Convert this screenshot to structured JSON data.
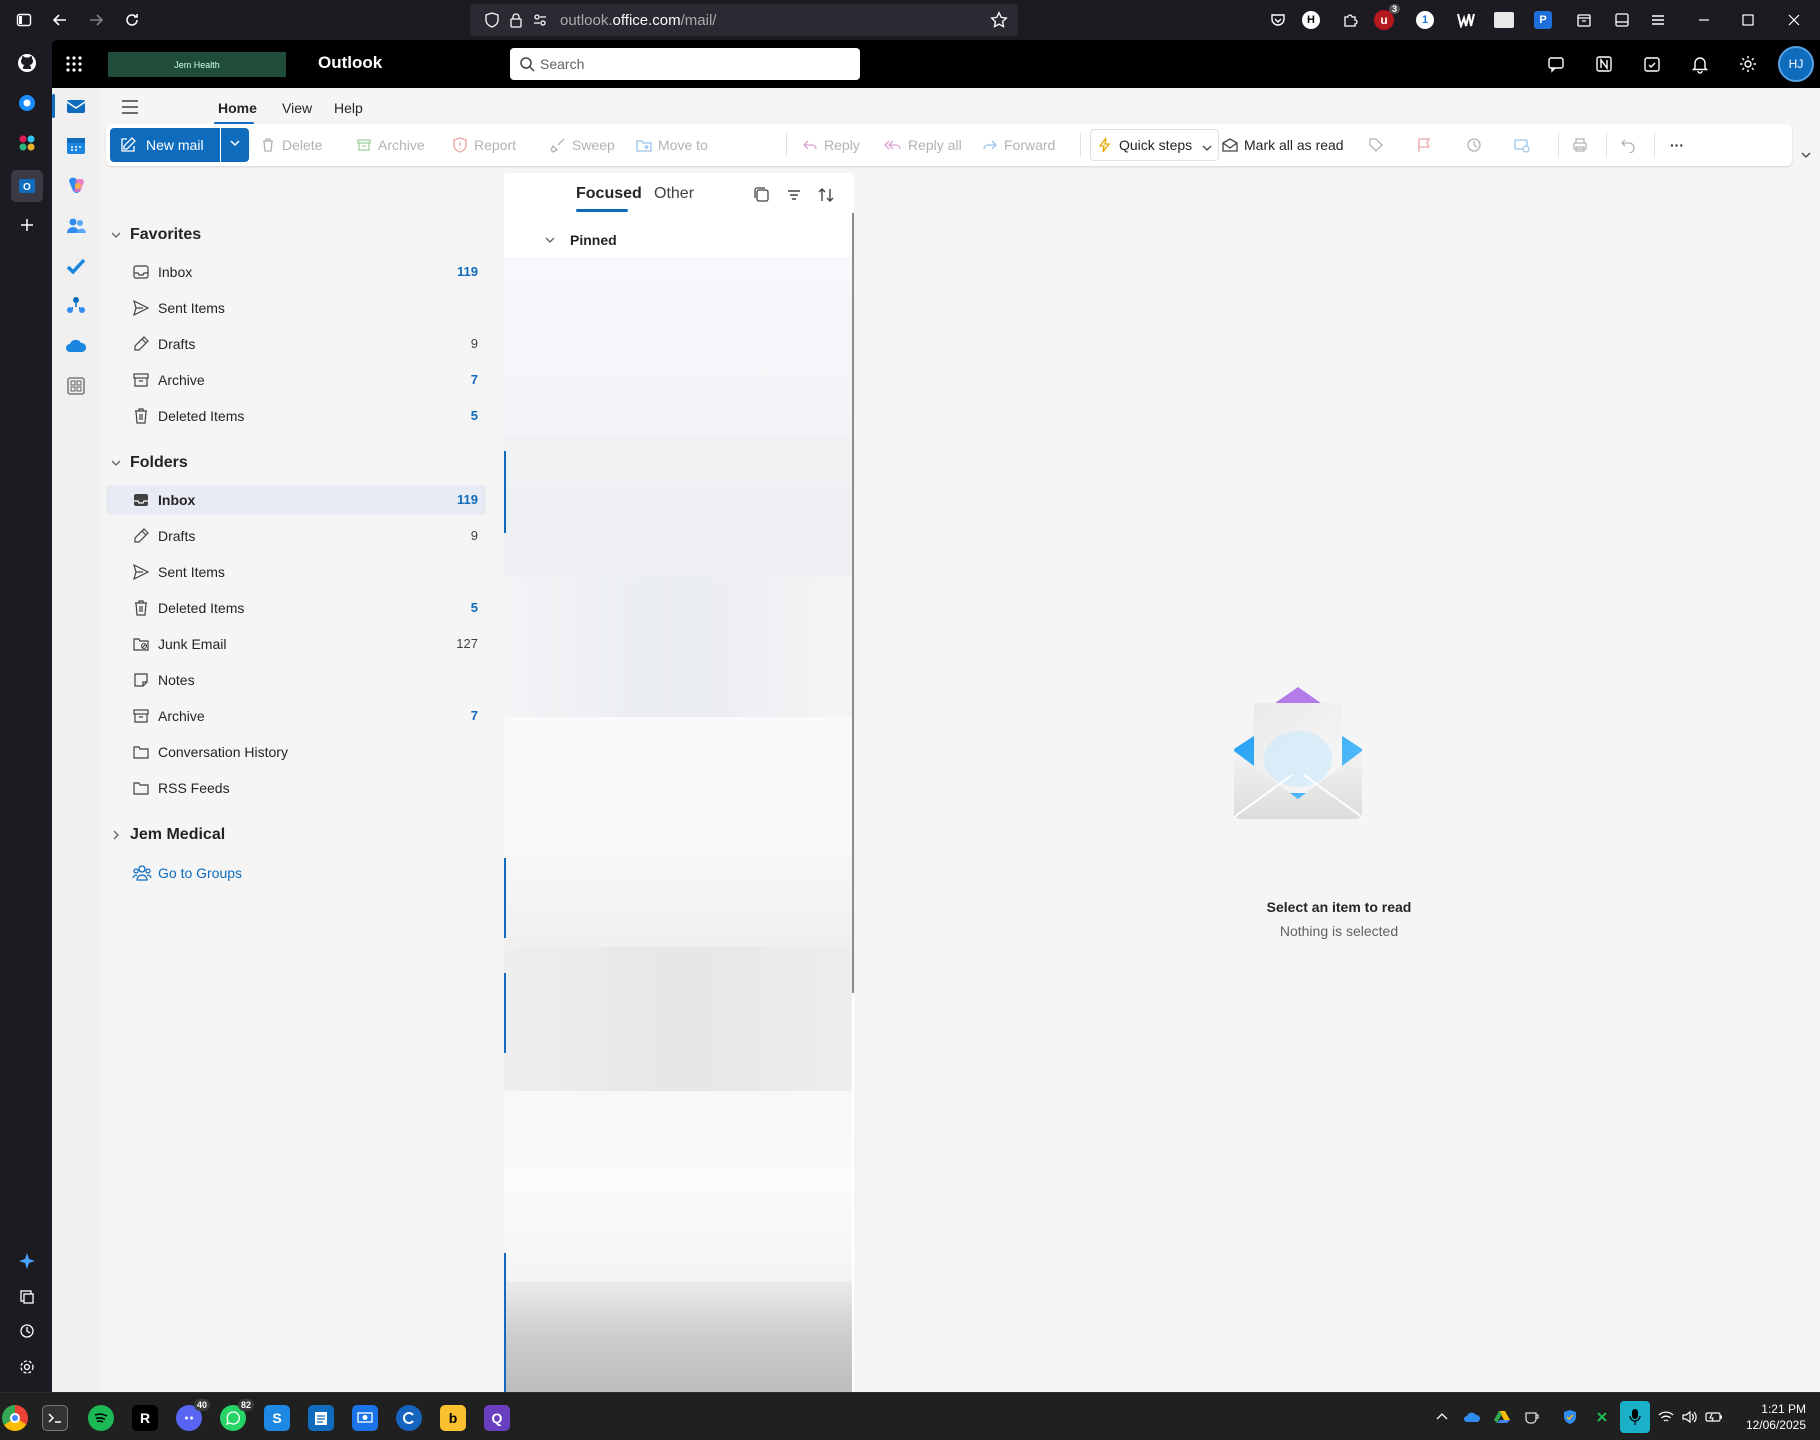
{
  "browser": {
    "url_prefix": "outlook.",
    "url_domain": "office.com",
    "url_path": "/mail/",
    "extension_badge": "3"
  },
  "header": {
    "org_logo_text": "Jem Health",
    "app_title": "Outlook",
    "search_placeholder": "Search",
    "avatar_initials": "HJ"
  },
  "ribbon": {
    "tabs": [
      "Home",
      "View",
      "Help"
    ],
    "new_mail": "New mail",
    "delete": "Delete",
    "archive": "Archive",
    "report": "Report",
    "sweep": "Sweep",
    "move_to": "Move to",
    "reply": "Reply",
    "reply_all": "Reply all",
    "forward": "Forward",
    "quick_steps": "Quick steps",
    "mark_all_read": "Mark all as read",
    "more": "···"
  },
  "folders": {
    "favorites_title": "Favorites",
    "favorites": [
      {
        "label": "Inbox",
        "count": "119"
      },
      {
        "label": "Sent Items",
        "count": ""
      },
      {
        "label": "Drafts",
        "count": "9"
      },
      {
        "label": "Archive",
        "count": "7"
      },
      {
        "label": "Deleted Items",
        "count": "5"
      }
    ],
    "folders_title": "Folders",
    "items": [
      {
        "label": "Inbox",
        "count": "119"
      },
      {
        "label": "Drafts",
        "count": "9"
      },
      {
        "label": "Sent Items",
        "count": ""
      },
      {
        "label": "Deleted Items",
        "count": "5"
      },
      {
        "label": "Junk Email",
        "count": "127"
      },
      {
        "label": "Notes",
        "count": ""
      },
      {
        "label": "Archive",
        "count": "7"
      },
      {
        "label": "Conversation History",
        "count": ""
      },
      {
        "label": "RSS Feeds",
        "count": ""
      }
    ],
    "group_title": "Jem Medical",
    "go_to_groups": "Go to Groups"
  },
  "message_list": {
    "focused": "Focused",
    "other": "Other",
    "pinned": "Pinned"
  },
  "reading_pane": {
    "title": "Select an item to read",
    "subtitle": "Nothing is selected"
  },
  "taskbar": {
    "badge_1": "40",
    "badge_2": "82",
    "time": "1:21 PM",
    "date": "12/06/2025"
  },
  "colors": {
    "accent": "#0f6cbd",
    "header": "#000000"
  }
}
